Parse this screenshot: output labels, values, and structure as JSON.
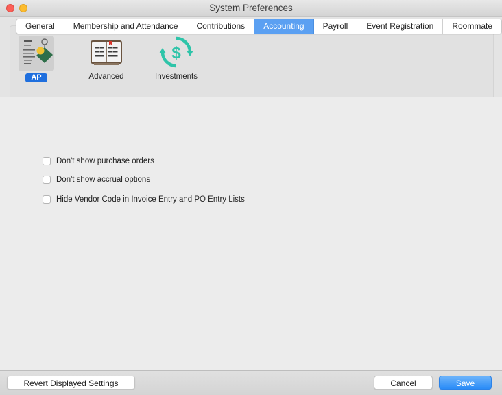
{
  "window": {
    "title": "System Preferences"
  },
  "tabs": [
    {
      "label": "General"
    },
    {
      "label": "Membership and Attendance"
    },
    {
      "label": "Contributions"
    },
    {
      "label": "Accounting"
    },
    {
      "label": "Payroll"
    },
    {
      "label": "Event Registration"
    },
    {
      "label": "Roommate"
    }
  ],
  "active_tab": "Accounting",
  "toolbar": {
    "items": [
      {
        "label": "AP",
        "icon": "ap-document-icon",
        "selected": true
      },
      {
        "label": "Advanced",
        "icon": "ledger-book-icon"
      },
      {
        "label": "Investments",
        "icon": "dollar-refresh-icon"
      }
    ]
  },
  "options": [
    {
      "label": "Don't show purchase orders",
      "checked": false
    },
    {
      "label": "Don't show accrual options",
      "checked": false
    },
    {
      "label": "Hide Vendor Code in Invoice Entry and PO Entry Lists",
      "checked": false
    }
  ],
  "footer": {
    "revert_label": "Revert Displayed Settings",
    "cancel_label": "Cancel",
    "save_label": "Save"
  },
  "colors": {
    "accent": "#5ba0f2",
    "selected_label": "#1f6fde",
    "investments_icon": "#2ec4a9"
  }
}
